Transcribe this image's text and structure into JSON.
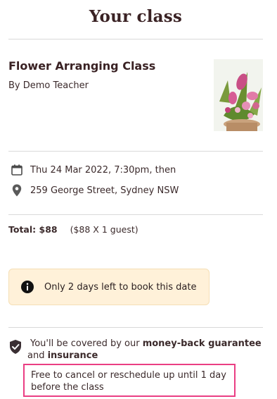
{
  "header": {
    "title": "Your class"
  },
  "class": {
    "title": "Flower Arranging Class",
    "teacher": "By Demo Teacher",
    "image_icon": "flower-arrangement-photo"
  },
  "details": {
    "date": "Thu 24 Mar 2022, 7:30pm, then",
    "date_icon": "calendar-icon",
    "location": "259 George Street, Sydney NSW",
    "location_icon": "map-pin-icon"
  },
  "pricing": {
    "total_label": "Total: $88",
    "breakdown": "($88 X 1 guest)"
  },
  "notice": {
    "text": "Only 2 days left to book this date",
    "icon": "info-icon",
    "background": "#fff1d9"
  },
  "guarantee": {
    "prefix": "You'll be covered by our ",
    "strong1": "money-back guarantee",
    "middle": " and ",
    "strong2": "insurance",
    "icon": "shield-check-icon",
    "cancel_text": "Free to cancel or reschedule up until 1 day before the class",
    "highlight_color": "#ea3e83"
  }
}
